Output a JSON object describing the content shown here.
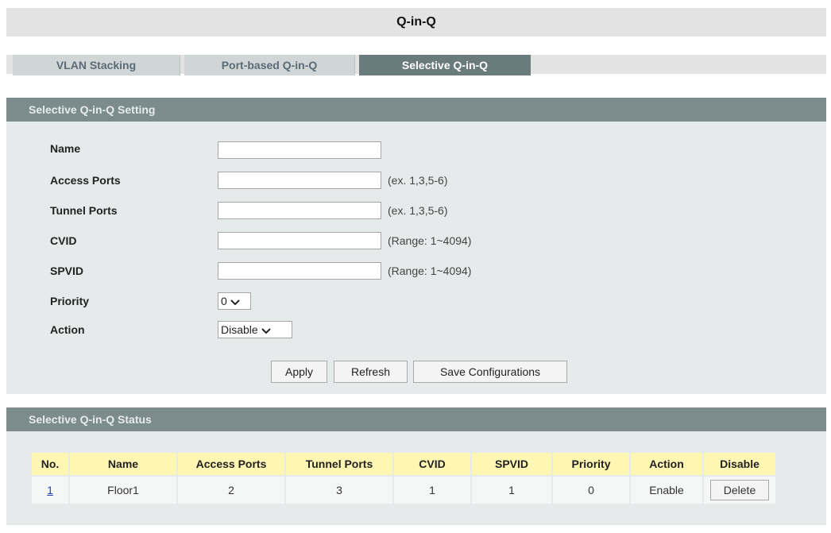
{
  "page_title": "Q-in-Q",
  "tabs": [
    {
      "label": "VLAN Stacking",
      "active": false
    },
    {
      "label": "Port-based Q-in-Q",
      "active": false
    },
    {
      "label": "Selective Q-in-Q",
      "active": true
    }
  ],
  "setting": {
    "header": "Selective Q-in-Q Setting",
    "fields": [
      {
        "label": "Name",
        "value": "",
        "hint": ""
      },
      {
        "label": "Access Ports",
        "value": "",
        "hint": "(ex. 1,3,5-6)"
      },
      {
        "label": "Tunnel Ports",
        "value": "",
        "hint": "(ex. 1,3,5-6)"
      },
      {
        "label": "CVID",
        "value": "",
        "hint": "(Range: 1~4094)"
      },
      {
        "label": "SPVID",
        "value": "",
        "hint": "(Range: 1~4094)"
      }
    ],
    "priority": {
      "label": "Priority",
      "selected": "0"
    },
    "action": {
      "label": "Action",
      "selected": "Disable"
    },
    "buttons": {
      "apply": "Apply",
      "refresh": "Refresh",
      "save": "Save Configurations"
    }
  },
  "status": {
    "header": "Selective Q-in-Q Status",
    "columns": [
      "No.",
      "Name",
      "Access Ports",
      "Tunnel Ports",
      "CVID",
      "SPVID",
      "Priority",
      "Action",
      "Disable"
    ],
    "rows": [
      {
        "no": "1",
        "name": "Floor1",
        "access_ports": "2",
        "tunnel_ports": "3",
        "cvid": "1",
        "spvid": "1",
        "priority": "0",
        "action": "Enable",
        "delete_label": "Delete"
      }
    ]
  },
  "colors": {
    "panel_header": "#7c8b8b",
    "active_tab": "#6a7b7e",
    "table_header": "#fff6b3"
  }
}
